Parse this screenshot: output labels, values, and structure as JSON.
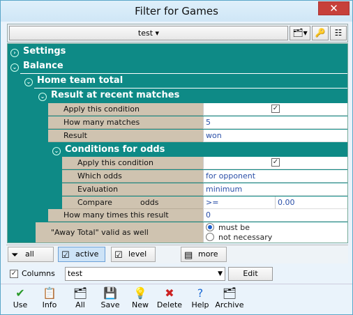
{
  "window": {
    "title": "Filter for Games",
    "close": "✕"
  },
  "toolbar": {
    "preset": "test ▾"
  },
  "tree": {
    "settings": "Settings",
    "balance": "Balance",
    "home_team_total": "Home team total",
    "result_recent": "Result at recent matches",
    "rows1": [
      {
        "label": "Apply this condition",
        "value": "✓"
      },
      {
        "label": "How many matches",
        "value": "5"
      },
      {
        "label": "Result",
        "value": "won"
      }
    ],
    "conditions_odds": "Conditions for odds",
    "rows2": [
      {
        "label": "Apply this condition",
        "value": "✓"
      },
      {
        "label": "Which odds",
        "value": "for opponent"
      },
      {
        "label": "Evaluation",
        "value": "minimum"
      }
    ],
    "compare": {
      "label1": "Compare",
      "label2": "odds",
      "op": ">=",
      "val": "0.00"
    },
    "times": {
      "label": "How many times this result",
      "value": "0"
    },
    "away": {
      "label": "\"Away Total\" valid as well",
      "opt1": "must be",
      "opt2": "not necessary"
    }
  },
  "filters": {
    "all": "all",
    "active": "active",
    "level": "level",
    "more": "more ..."
  },
  "columns": {
    "check_label": "Columns",
    "select": "test",
    "edit": "Edit"
  },
  "bottom": [
    "Use",
    "Info",
    "All",
    "Save",
    "New",
    "Delete",
    "Help",
    "Archive"
  ]
}
